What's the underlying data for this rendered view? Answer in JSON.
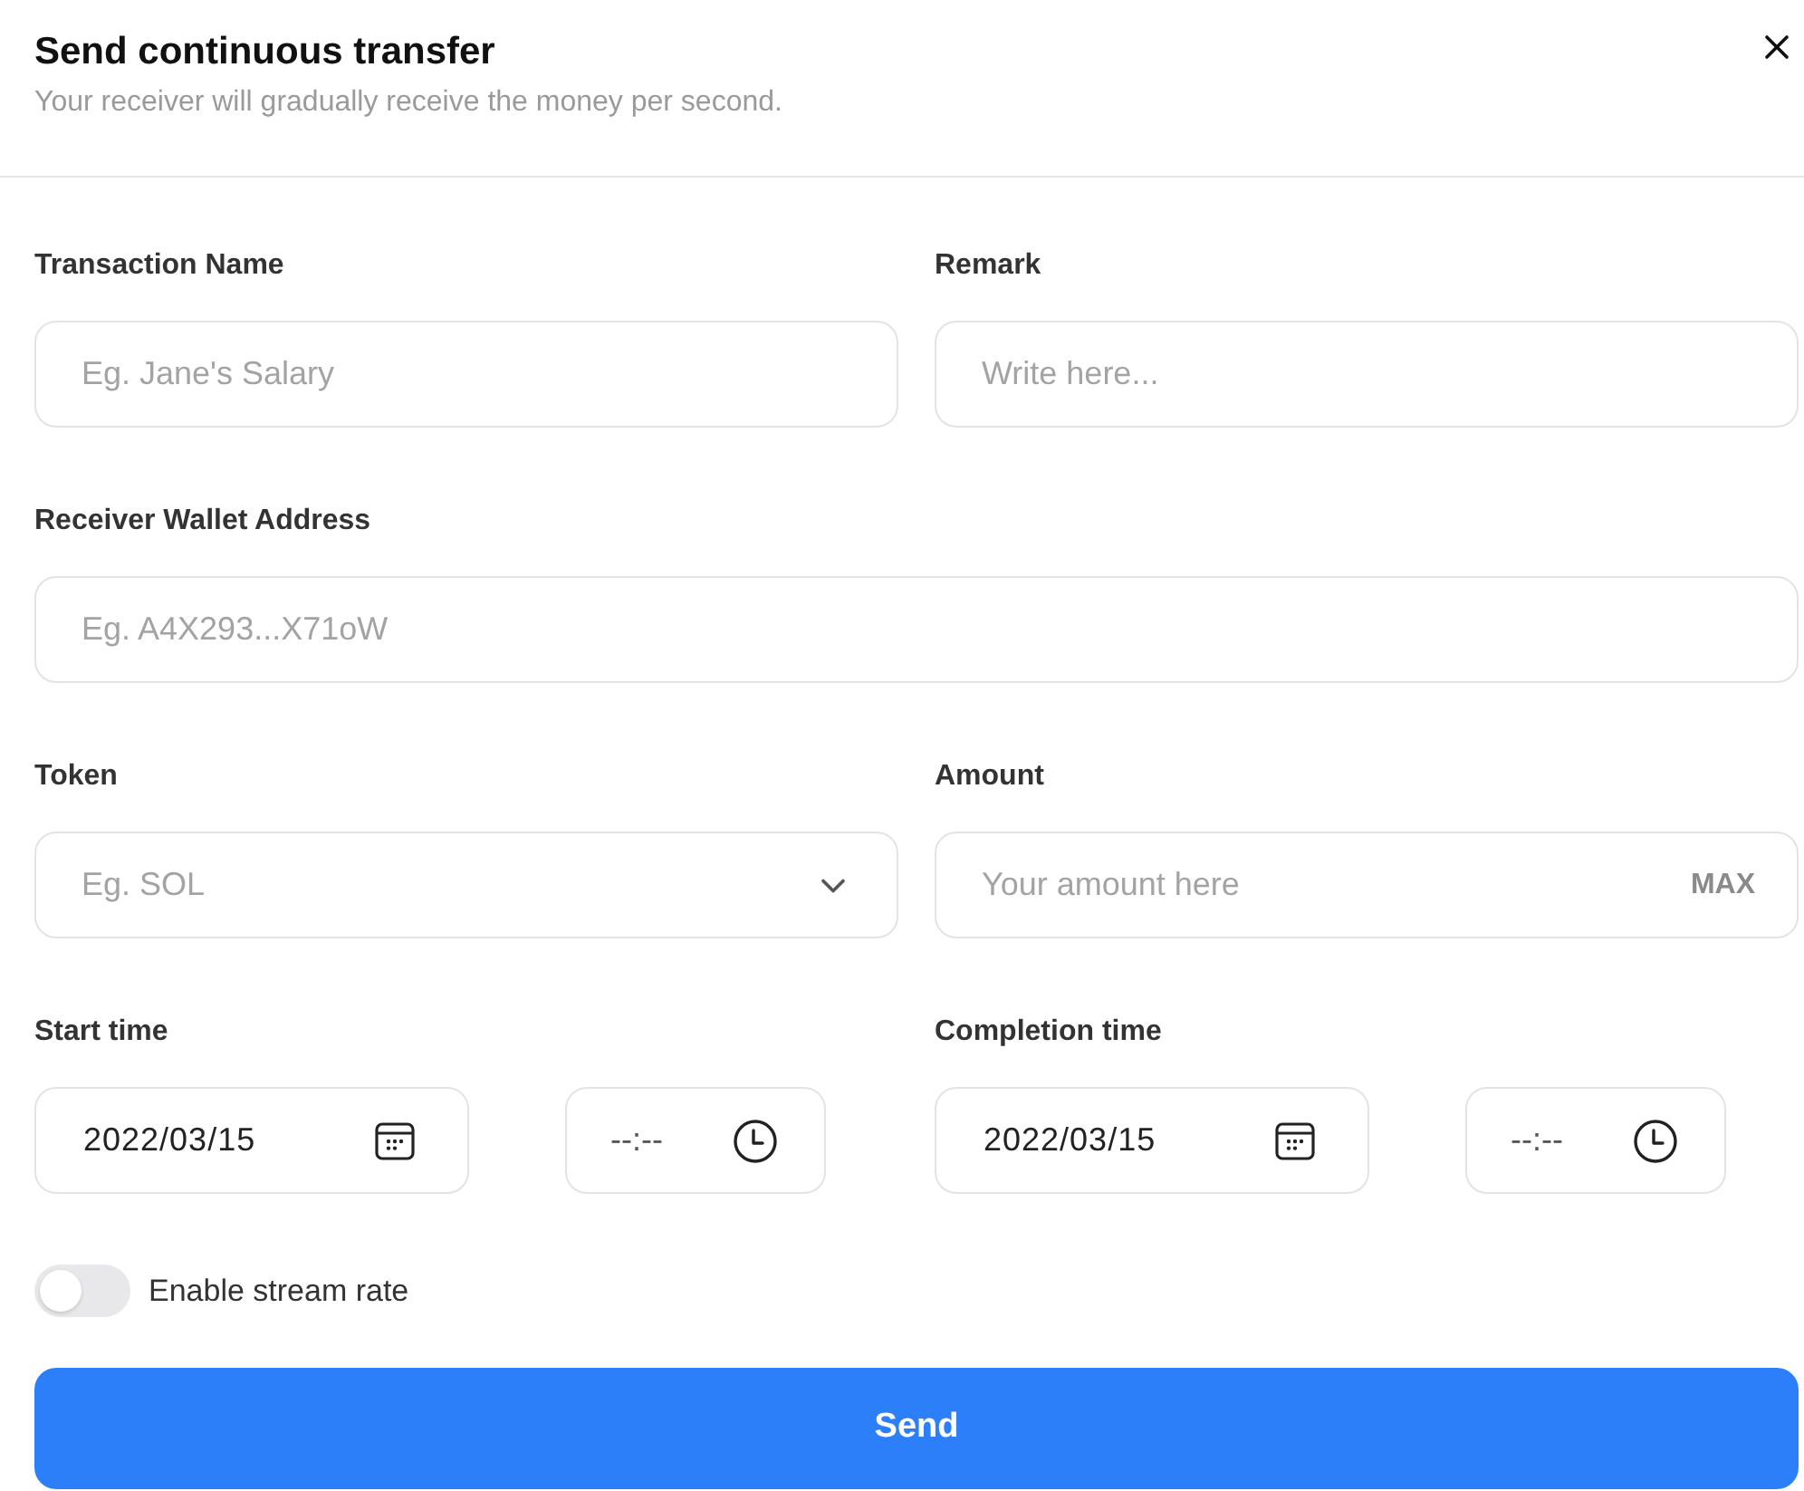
{
  "dialog": {
    "title": "Send continuous transfer",
    "subtitle": "Your receiver will gradually receive the money per second."
  },
  "rows": [
    {
      "fields": [
        {
          "kind": "text",
          "label": "Transaction Name",
          "placeholder": "Eg. Jane's Salary"
        },
        {
          "kind": "text",
          "label": "Remark",
          "placeholder": "Write here..."
        }
      ]
    },
    {
      "fields": [
        {
          "kind": "text",
          "label": "Receiver Wallet Address",
          "placeholder": "Eg. A4X293...X71oW"
        }
      ]
    },
    {
      "fields": [
        {
          "kind": "select",
          "label": "Token",
          "placeholder": "Eg. SOL"
        },
        {
          "kind": "amount",
          "label": "Amount",
          "placeholder": "Your amount here",
          "action": "MAX"
        }
      ]
    },
    {
      "fields": [
        {
          "kind": "datetime",
          "label": "Start time",
          "date": "2022/03/15",
          "time": "--:--"
        },
        {
          "kind": "datetime",
          "label": "Completion time",
          "date": "2022/03/15",
          "time": "--:--"
        }
      ]
    }
  ],
  "toggle": {
    "label": "Enable stream rate",
    "on": false
  },
  "submit": "Send"
}
